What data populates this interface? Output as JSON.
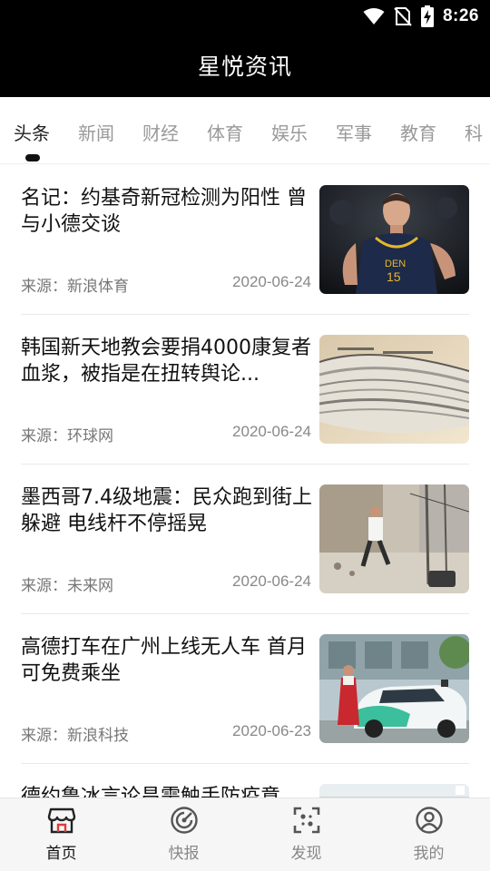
{
  "status_bar": {
    "time": "8:26",
    "icons": [
      "wifi-icon",
      "no-sim-icon",
      "battery-charging-icon"
    ]
  },
  "app_bar": {
    "title": "星悦资讯"
  },
  "tabs": [
    {
      "label": "头条",
      "active": true
    },
    {
      "label": "新闻",
      "active": false
    },
    {
      "label": "财经",
      "active": false
    },
    {
      "label": "体育",
      "active": false
    },
    {
      "label": "娱乐",
      "active": false
    },
    {
      "label": "军事",
      "active": false
    },
    {
      "label": "教育",
      "active": false
    },
    {
      "label": "科",
      "active": false
    }
  ],
  "news": [
    {
      "title": "名记：约基奇新冠检测为阳性 曾与小德交谈",
      "source": "来源：新浪体育",
      "date": "2020-06-24",
      "thumb": "basketball-player-photo"
    },
    {
      "title": "韩国新天地教会要捐4000康复者血浆，被指是在扭转舆论...",
      "source": "来源：环球网",
      "date": "2020-06-24",
      "thumb": "newspaper-stack-photo"
    },
    {
      "title": "墨西哥7.4级地震：民众跑到街上躲避 电线杆不停摇晃",
      "source": "来源：未来网",
      "date": "2020-06-24",
      "thumb": "earthquake-street-photo"
    },
    {
      "title": "高德打车在广州上线无人车 首月可免费乘坐",
      "source": "来源：新浪科技",
      "date": "2020-06-23",
      "thumb": "driverless-car-photo"
    },
    {
      "title": "德约鲁冰言论昌需触手防疫意",
      "source": "",
      "date": "",
      "thumb": "partial-photo"
    }
  ],
  "bottom_nav": [
    {
      "label": "首页",
      "icon": "store-home-icon",
      "active": true
    },
    {
      "label": "快报",
      "icon": "radar-icon",
      "active": false
    },
    {
      "label": "发现",
      "icon": "scan-discover-icon",
      "active": false
    },
    {
      "label": "我的",
      "icon": "user-profile-icon",
      "active": false
    }
  ],
  "colors": {
    "bar_background": "#000000",
    "active_text": "#111111",
    "inactive_text": "#999999",
    "nav_background": "#f6f6f6"
  }
}
